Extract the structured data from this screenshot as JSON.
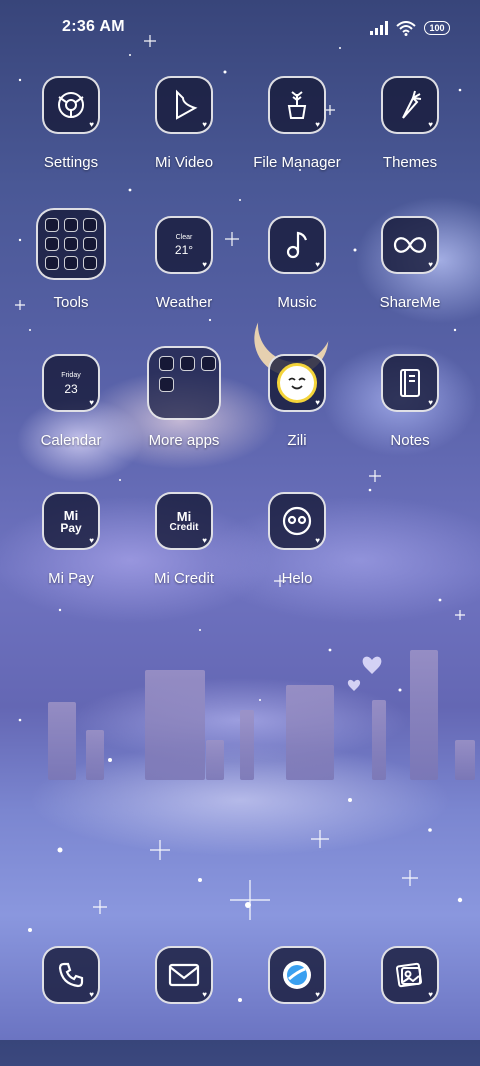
{
  "status_bar": {
    "time": "2:36 AM",
    "battery": "100"
  },
  "apps": [
    {
      "name": "Settings",
      "icon": "settings-icon"
    },
    {
      "name": "Mi Video",
      "icon": "mi-video-icon"
    },
    {
      "name": "File Manager",
      "icon": "file-manager-icon"
    },
    {
      "name": "Themes",
      "icon": "themes-icon"
    },
    {
      "name": "Tools",
      "icon": "tools-folder-icon"
    },
    {
      "name": "Weather",
      "icon": "weather-icon",
      "condition": "Clear",
      "temp": "21°"
    },
    {
      "name": "Music",
      "icon": "music-note-icon"
    },
    {
      "name": "ShareMe",
      "icon": "shareme-icon"
    },
    {
      "name": "Calendar",
      "icon": "calendar-icon",
      "day": "Friday",
      "date": "23"
    },
    {
      "name": "More apps",
      "icon": "more-apps-folder-icon"
    },
    {
      "name": "Zili",
      "icon": "zili-icon"
    },
    {
      "name": "Notes",
      "icon": "notes-icon"
    },
    {
      "name": "Mi Pay",
      "icon": "mi-pay-icon",
      "badge_top": "Mi",
      "badge_bottom": "Pay"
    },
    {
      "name": "Mi Credit",
      "icon": "mi-credit-icon",
      "badge_top": "Mi",
      "badge_bottom": "Credit"
    },
    {
      "name": "Helo",
      "icon": "helo-icon"
    }
  ],
  "dock": [
    {
      "icon": "phone-icon"
    },
    {
      "icon": "messaging-icon"
    },
    {
      "icon": "browser-icon"
    },
    {
      "icon": "gallery-icon"
    }
  ],
  "colors": {
    "tile_bg": "#191c3c",
    "tile_border": "#ffffff",
    "zili_yellow": "#f4d43a",
    "browser_blue": "#3aa0f0"
  }
}
